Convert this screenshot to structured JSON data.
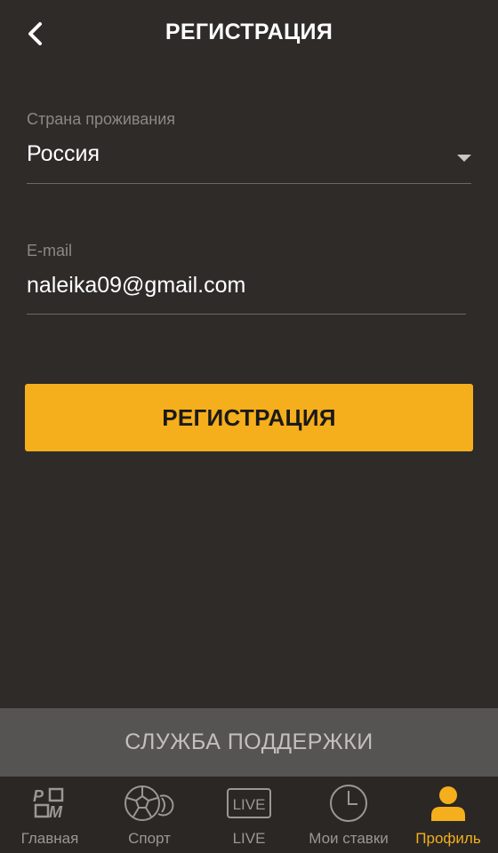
{
  "header": {
    "title": "РЕГИСТРАЦИЯ",
    "back_icon": "chevron-left-icon"
  },
  "form": {
    "country": {
      "label": "Страна проживания",
      "value": "Россия"
    },
    "email": {
      "label": "E-mail",
      "value": "naleika09@gmail.com"
    },
    "submit_label": "РЕГИСТРАЦИЯ"
  },
  "support_label": "СЛУЖБА ПОДДЕРЖКИ",
  "tabbar": {
    "items": [
      {
        "label": "Главная",
        "icon": "logo-icon"
      },
      {
        "label": "Спорт",
        "icon": "ball-icon"
      },
      {
        "label": "LIVE",
        "icon": "live-icon",
        "icon_text": "LIVE"
      },
      {
        "label": "Мои ставки",
        "icon": "clock-icon"
      },
      {
        "label": "Профиль",
        "icon": "profile-icon",
        "active": true
      }
    ]
  },
  "colors": {
    "accent": "#f5ae1c",
    "background": "#2e2b29",
    "support_bar": "#565452",
    "tabbar": "#2a2725"
  }
}
